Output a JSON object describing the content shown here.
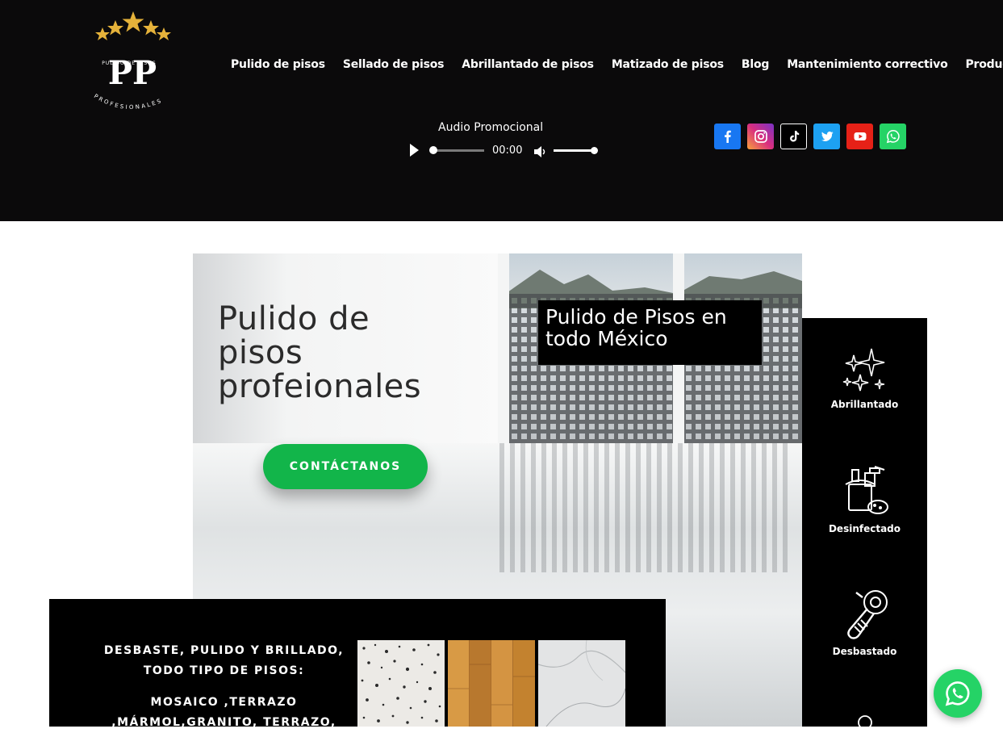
{
  "logo": {
    "monogram": "PP",
    "top_text": "PULIDO DE PISOS",
    "bottom_text": "PROFESIONALES"
  },
  "nav": {
    "items": [
      {
        "label": "Pulido de pisos"
      },
      {
        "label": "Sellado de pisos"
      },
      {
        "label": "Abrillantado de pisos"
      },
      {
        "label": "Matizado de pisos"
      },
      {
        "label": "Blog"
      },
      {
        "label": "Mantenimiento correctivo"
      },
      {
        "label": "Productos"
      }
    ]
  },
  "audio": {
    "label": "Audio Promocional",
    "time": "00:00",
    "progress": 0,
    "volume": 1
  },
  "socials": [
    {
      "icon": "facebook-icon",
      "color": "#1877f2"
    },
    {
      "icon": "instagram-icon",
      "color": "#c13584"
    },
    {
      "icon": "tiktok-icon",
      "color": "#000000"
    },
    {
      "icon": "twitter-icon",
      "color": "#1da1f2"
    },
    {
      "icon": "youtube-icon",
      "color": "#e62117"
    },
    {
      "icon": "whatsapp-icon",
      "color": "#25d366"
    }
  ],
  "hero": {
    "title": "Pulido de pisos profeionales",
    "cta": "CONTÁCTANOS",
    "badge": "Pulido de Pisos en todo México"
  },
  "services": {
    "items": [
      {
        "label": "Abrillantado",
        "icon": "sparkles-icon"
      },
      {
        "label": "Desinfectado",
        "icon": "cleaning-supplies-icon"
      },
      {
        "label": "Desbastado",
        "icon": "angle-grinder-icon"
      }
    ]
  },
  "bottom": {
    "heading": "DESBASTE, PULIDO Y BRILLADO, TODO TIPO DE PISOS:",
    "types": "MOSAICO ,TERRAZO ,MÁRMOL,GRANITO, TERRAZO,"
  },
  "colors": {
    "accent_green": "#12b54a",
    "header_bg": "#0b0a0b",
    "gold": "#e5b23a"
  }
}
